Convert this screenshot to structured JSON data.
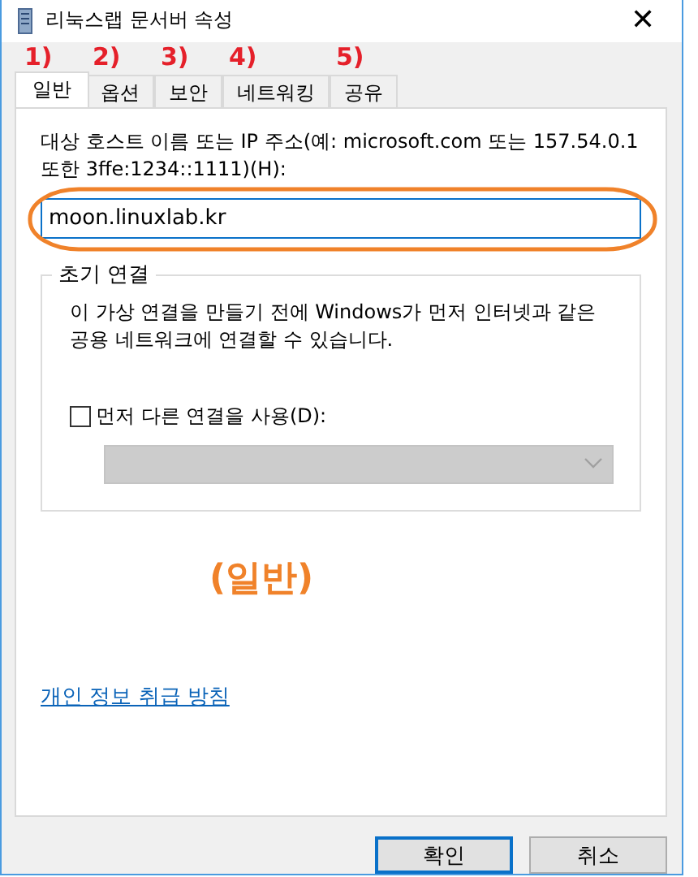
{
  "window": {
    "title": "리눅스랩 문서버 속성",
    "close": "✕"
  },
  "tabs": [
    {
      "label": "일반",
      "selected": true,
      "marker": "1)"
    },
    {
      "label": "옵션",
      "selected": false,
      "marker": "2)"
    },
    {
      "label": "보안",
      "selected": false,
      "marker": "3)"
    },
    {
      "label": "네트워킹",
      "selected": false,
      "marker": "4)"
    },
    {
      "label": "공유",
      "selected": false,
      "marker": "5)"
    }
  ],
  "host": {
    "label": "대상 호스트 이름 또는 IP 주소(예: microsoft.com 또는 157.54.0.1 또한 3ffe:1234::1111)(H):",
    "value": "moon.linuxlab.kr",
    "highlighted": true
  },
  "initial_connection": {
    "title": "초기 연결",
    "description": "이 가상 연결을 만들기 전에 Windows가 먼저 인터넷과 같은 공용 네트워크에 연결할 수 있습니다.",
    "checkbox": {
      "label": "먼저 다른 연결을 사용(D):",
      "checked": false
    },
    "dropdown": {
      "disabled": true
    }
  },
  "caption": "(일반)",
  "privacy_link": "개인 정보 취급 방침",
  "buttons": [
    {
      "label": "확인",
      "default": true
    },
    {
      "label": "취소",
      "default": false
    }
  ]
}
